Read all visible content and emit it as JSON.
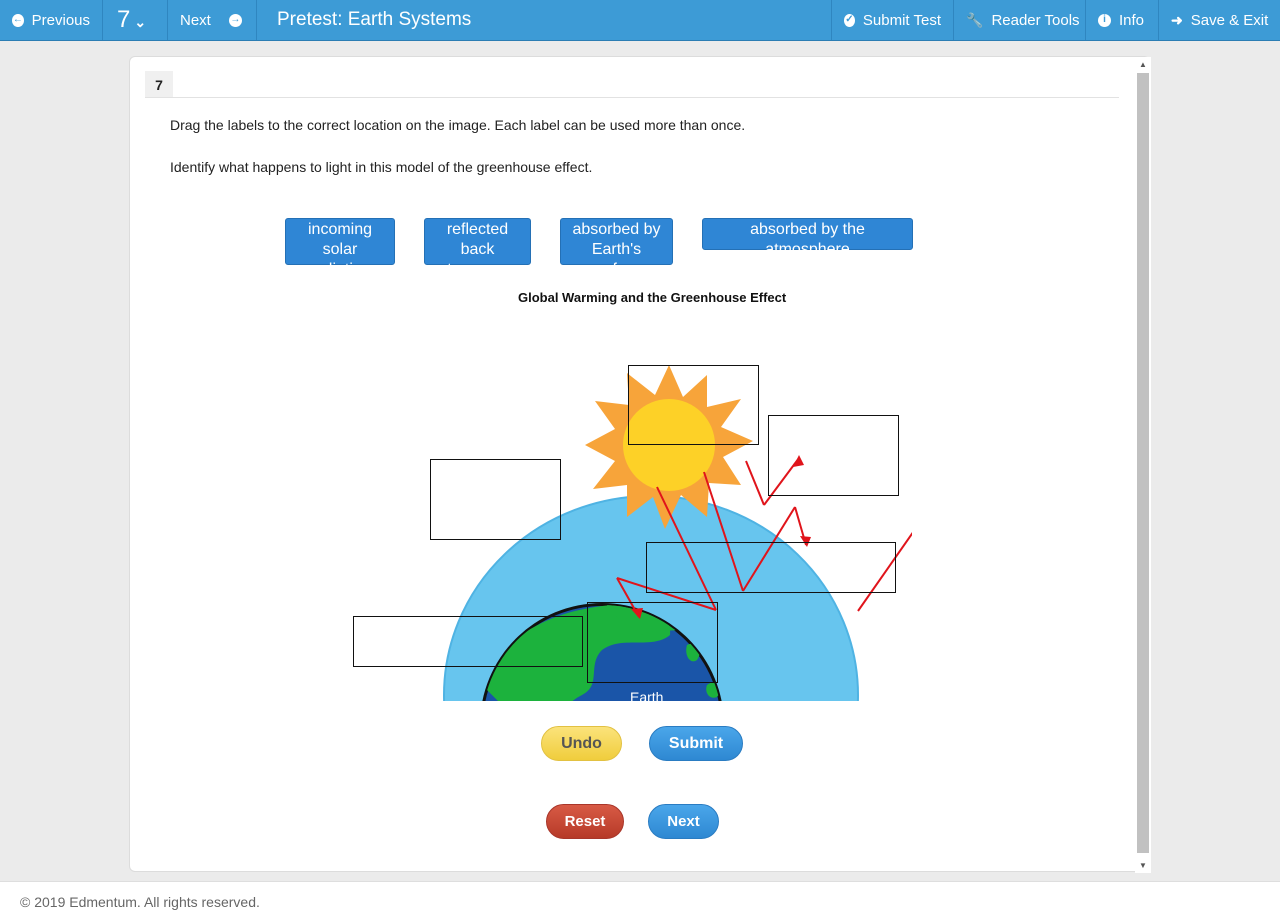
{
  "topbar": {
    "previous_label": "Previous",
    "question_number": "7",
    "next_label": "Next",
    "title": "Pretest: Earth Systems",
    "submit_test_label": "Submit Test",
    "reader_tools_label": "Reader Tools",
    "info_label": "Info",
    "save_exit_label": "Save & Exit"
  },
  "question": {
    "number": "7",
    "instruction": "Drag the labels to the correct location on the image. Each label can be used more than once.",
    "prompt": "Identify what happens to light in this model of the greenhouse effect."
  },
  "labels": [
    {
      "line1": "incoming solar",
      "line2": "radiation"
    },
    {
      "line1": "reflected back",
      "line2": "to space"
    },
    {
      "line1": "absorbed by",
      "line2": "Earth's surface"
    },
    {
      "line1": "absorbed by the atmosphere",
      "line2": ""
    }
  ],
  "diagram": {
    "title": "Global Warming and the Greenhouse Effect",
    "earth_label": "Earth"
  },
  "buttons": {
    "undo": "Undo",
    "submit": "Submit",
    "reset": "Reset",
    "next": "Next"
  },
  "footer": {
    "copyright": "© 2019 Edmentum. All rights reserved."
  },
  "colors": {
    "topbar": "#3d9bd6",
    "label_bg": "#2f86d5",
    "atmosphere": "#67c5ee",
    "ocean": "#1a55a8",
    "land": "#1cb23d",
    "sun_outer": "#f7a43a",
    "sun_inner": "#fdd127",
    "arrow": "#e0141b"
  }
}
